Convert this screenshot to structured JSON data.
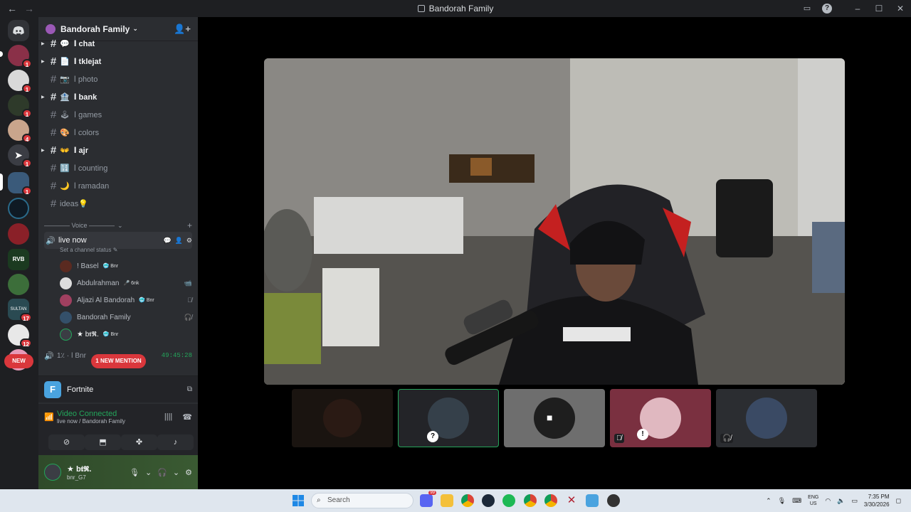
{
  "window": {
    "title": "Bandorah Family",
    "back_label": "←",
    "forward_label": "→",
    "inbox_icon": "inbox-icon",
    "help_label": "?",
    "minimize_label": "–",
    "maximize_label": "☐",
    "close_label": "✕"
  },
  "guilds": {
    "badges": [
      "1",
      "1",
      "1",
      "4",
      "1",
      "1",
      "",
      "",
      "",
      "",
      "17",
      "12"
    ],
    "new_label": "NEW",
    "rvb_label": "RVB",
    "sultan_label": "SULTAN"
  },
  "server": {
    "name": "Bandorah Family",
    "chevron": "⌄"
  },
  "channels": [
    {
      "emoji": "💬",
      "name": "ا chat",
      "unread": true
    },
    {
      "emoji": "📄",
      "name": "ا tklejat",
      "unread": true
    },
    {
      "emoji": "📷",
      "name": "ا photo",
      "unread": false
    },
    {
      "emoji": "🏦",
      "name": "ا bank",
      "unread": true
    },
    {
      "emoji": "🕹",
      "name": "ا games",
      "unread": false
    },
    {
      "emoji": "🎨",
      "name": "ا colors",
      "unread": false
    },
    {
      "emoji": "👐",
      "name": "ا ajr",
      "unread": true
    },
    {
      "emoji": "🔢",
      "name": "ا counting",
      "unread": false
    },
    {
      "emoji": "🌙",
      "name": "ا ramadan",
      "unread": false
    },
    {
      "emoji": "",
      "name": "ideas💡",
      "unread": false
    }
  ],
  "voice": {
    "category": "———— Voice ————",
    "channel_name": "live now",
    "status_prompt": "Set a channel status ✎",
    "users": [
      {
        "name": "! Basel",
        "tag": "🥶 Bnr",
        "icon": ""
      },
      {
        "name": "Abdulrahman",
        "tag": "🎤 6nk",
        "icon": "📹"
      },
      {
        "name": "Aljazi Al Bandorah",
        "tag": "🥶 Bnr",
        "icon": "🎙̸"
      },
      {
        "name": "Bandorah Family",
        "tag": "",
        "icon": "🎧̸"
      },
      {
        "name": "★   b𝖙𝕽.",
        "tag": "🥶 Bnr",
        "icon": ""
      }
    ],
    "second_channel": "1٪ · ا Bnr",
    "timer": "49:45:28",
    "mention_label": "1 NEW MENTION"
  },
  "activity": {
    "game": "Fortnite",
    "game_initial": "F"
  },
  "connection": {
    "status": "Video Connected",
    "location": "live now / Bandorah Family"
  },
  "user": {
    "name": "b𝖙𝕽.",
    "handle": "bnr_G7",
    "prefix": "★"
  },
  "taskbar": {
    "search_placeholder": "Search",
    "lang_top": "ENG",
    "lang_bottom": "US",
    "time": "7:35 PM",
    "date": "3/30/2026",
    "discord_badge": "99"
  },
  "colors": {
    "accent_green": "#23a55a",
    "notification_red": "#da373c",
    "sidebar_bg": "#2b2d31",
    "rail_bg": "#1e1f22"
  }
}
